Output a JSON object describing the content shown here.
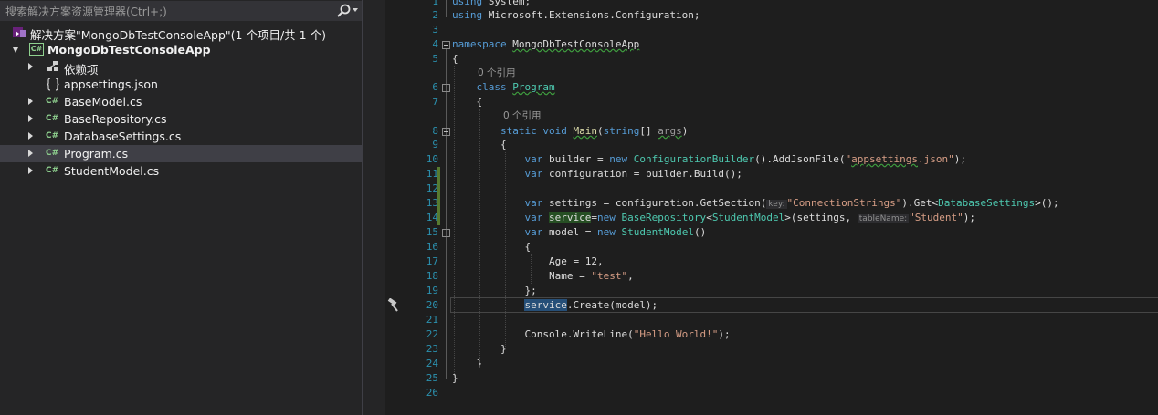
{
  "solution_explorer": {
    "search_placeholder": "搜索解决方案资源管理器(Ctrl+;)",
    "solution_label": "解决方案\"MongoDbTestConsoleApp\"(1 个项目/共 1 个)",
    "project_label": "MongoDbTestConsoleApp",
    "items": [
      {
        "label": "依赖项",
        "icon": "dependencies-icon"
      },
      {
        "label": "appsettings.json",
        "icon": "json-file-icon"
      },
      {
        "label": "BaseModel.cs",
        "icon": "csharp-file-icon"
      },
      {
        "label": "BaseRepository.cs",
        "icon": "csharp-file-icon"
      },
      {
        "label": "DatabaseSettings.cs",
        "icon": "csharp-file-icon"
      },
      {
        "label": "Program.cs",
        "icon": "csharp-file-icon",
        "selected": true
      },
      {
        "label": "StudentModel.cs",
        "icon": "csharp-file-icon"
      }
    ],
    "csharp_icon_text": "C#"
  },
  "editor": {
    "line_numbers": [
      "1",
      "2",
      "3",
      "4",
      "5",
      "6",
      "7",
      "8",
      "9",
      "10",
      "11",
      "12",
      "13",
      "14",
      "15",
      "16",
      "17",
      "18",
      "19",
      "20",
      "21",
      "22",
      "23",
      "24",
      "25",
      "26"
    ],
    "codelens": [
      "0 个引用",
      "0 个引用"
    ],
    "tokens": {
      "using": "using",
      "system": "System;",
      "ms_ext": "Microsoft.Extensions.Configuration;",
      "namespace": "namespace",
      "ns_name": "MongoDbTestConsoleApp",
      "open_brace": "{",
      "close_brace": "}",
      "class": "class",
      "class_name": "Program",
      "static": "static",
      "void": "void",
      "main": "Main",
      "string": "string",
      "brackets": "[] ",
      "args": "args",
      "lparen": "(",
      "rparen": ")",
      "var": "var",
      "builder_assign": " builder = ",
      "new": "new",
      "config_builder": "ConfigurationBuilder",
      "add_json": "().AddJsonFile(",
      "json_quote_open": "\"",
      "appsettings": "appsettings",
      "json_rest": ".json\"",
      "end_stmt": ");",
      "config_assign": " configuration = builder.Build();",
      "settings_assign": " settings = configuration.GetSection(",
      "key_hint": "key:",
      "conn_strings": "\"ConnectionStrings\"",
      "get_open": ").Get<",
      "db_settings": "DatabaseSettings",
      "get_close": ">();",
      "service": "service",
      "eq": "=",
      "base_repo": "BaseRepository",
      "lt": "<",
      "student_model": "StudentModel",
      "settings_arg": ">(settings, ",
      "table_hint": "tableName:",
      "student_str": "\"Student\"",
      "model_assign": " model = ",
      "new_sp": "new ",
      "parens": "()",
      "age_line": "Age = 12,",
      "name_eq": "Name = ",
      "test_str": "\"test\"",
      "comma": ",",
      "close_init": "};",
      "create_call": ".Create(model);",
      "console": "Console.WriteLine(",
      "hello": "\"Hello World!\""
    }
  }
}
